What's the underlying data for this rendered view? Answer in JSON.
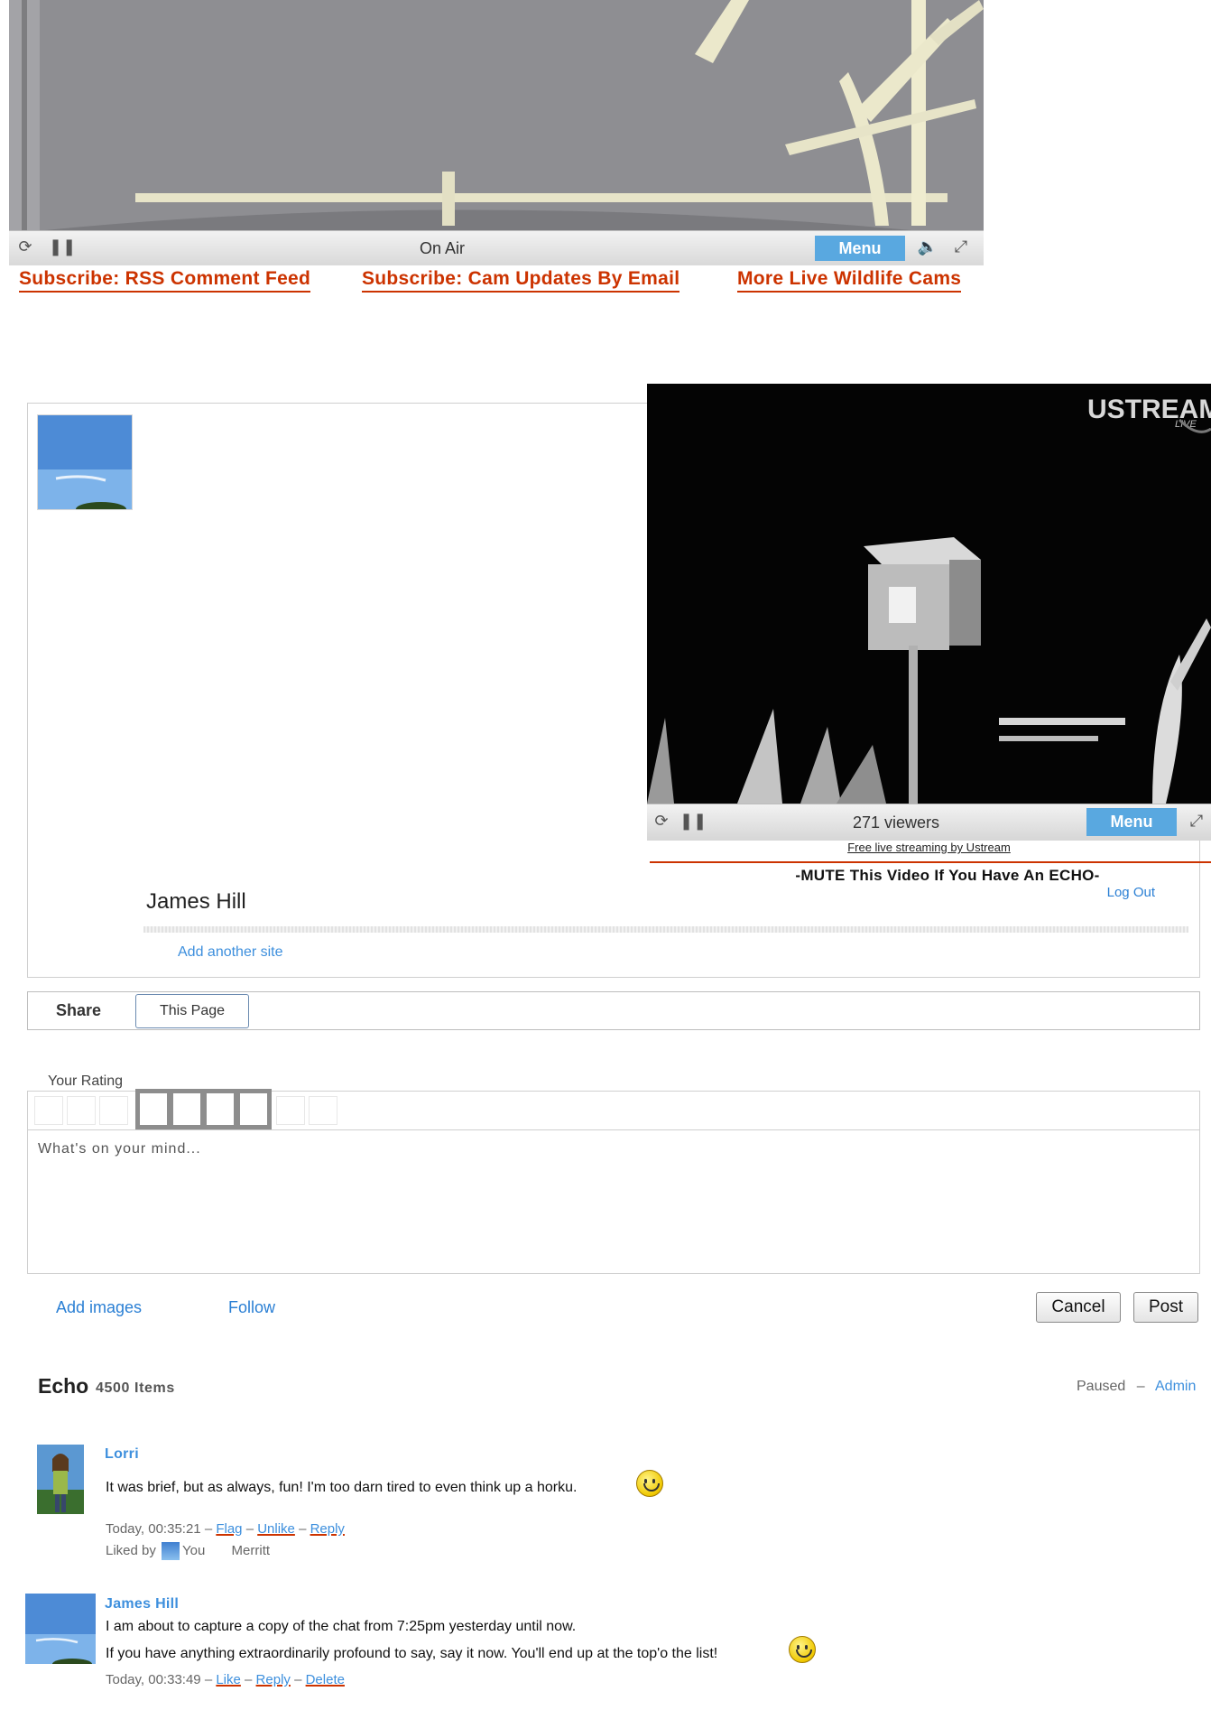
{
  "player_top": {
    "status": "On Air",
    "menu_label": "Menu",
    "icons": [
      "refresh-icon",
      "pause-icon",
      "volume-icon",
      "fullscreen-icon"
    ]
  },
  "subscribe": {
    "rss": "Subscribe: RSS Comment Feed",
    "email": "Subscribe: Cam Updates By Email",
    "more": "More Live Wildlife Cams"
  },
  "ustream": {
    "brand": "USTREAM",
    "brand_sub": "LIVE",
    "status": "271 viewers",
    "menu_label": "Menu",
    "free_streaming": "Free live streaming by Ustream",
    "mute_note": "-MUTE This Video If You Have An ECHO-"
  },
  "profile": {
    "name": "James Hill",
    "logout": "Log Out",
    "add_site": "Add another site"
  },
  "share": {
    "label": "Share",
    "target": "This Page"
  },
  "rating": {
    "label": "Your Rating",
    "selected": 4
  },
  "composer": {
    "placeholder": "What's on your mind...",
    "add_images": "Add images",
    "follow": "Follow",
    "cancel": "Cancel",
    "post": "Post"
  },
  "feed": {
    "title": "Echo",
    "count": "4500 Items",
    "paused": "Paused",
    "separator": "–",
    "admin": "Admin",
    "posts": [
      {
        "author": "Lorri",
        "lines": [
          "It was brief, but as always, fun!  I'm too darn tired to even think up a horku."
        ],
        "time": "Today, 00:35:21",
        "actions": [
          "Flag",
          "Unlike",
          "Reply"
        ],
        "liked_by_label": "Liked by",
        "liked_by": [
          "You",
          "Merritt"
        ]
      },
      {
        "author": "James Hill",
        "lines": [
          "I am about to capture a copy of the chat from 7:25pm yesterday until now.",
          "If you have anything extraordinarily profound to say, say it now.  You'll end up at the top'o the list!"
        ],
        "time": "Today, 00:33:49",
        "actions": [
          "Like",
          "Reply",
          "Delete"
        ]
      }
    ]
  },
  "colors": {
    "accent_link": "#3d8fdd",
    "subscribe_red": "#cc3300",
    "menu_blue": "#59a8e0"
  }
}
